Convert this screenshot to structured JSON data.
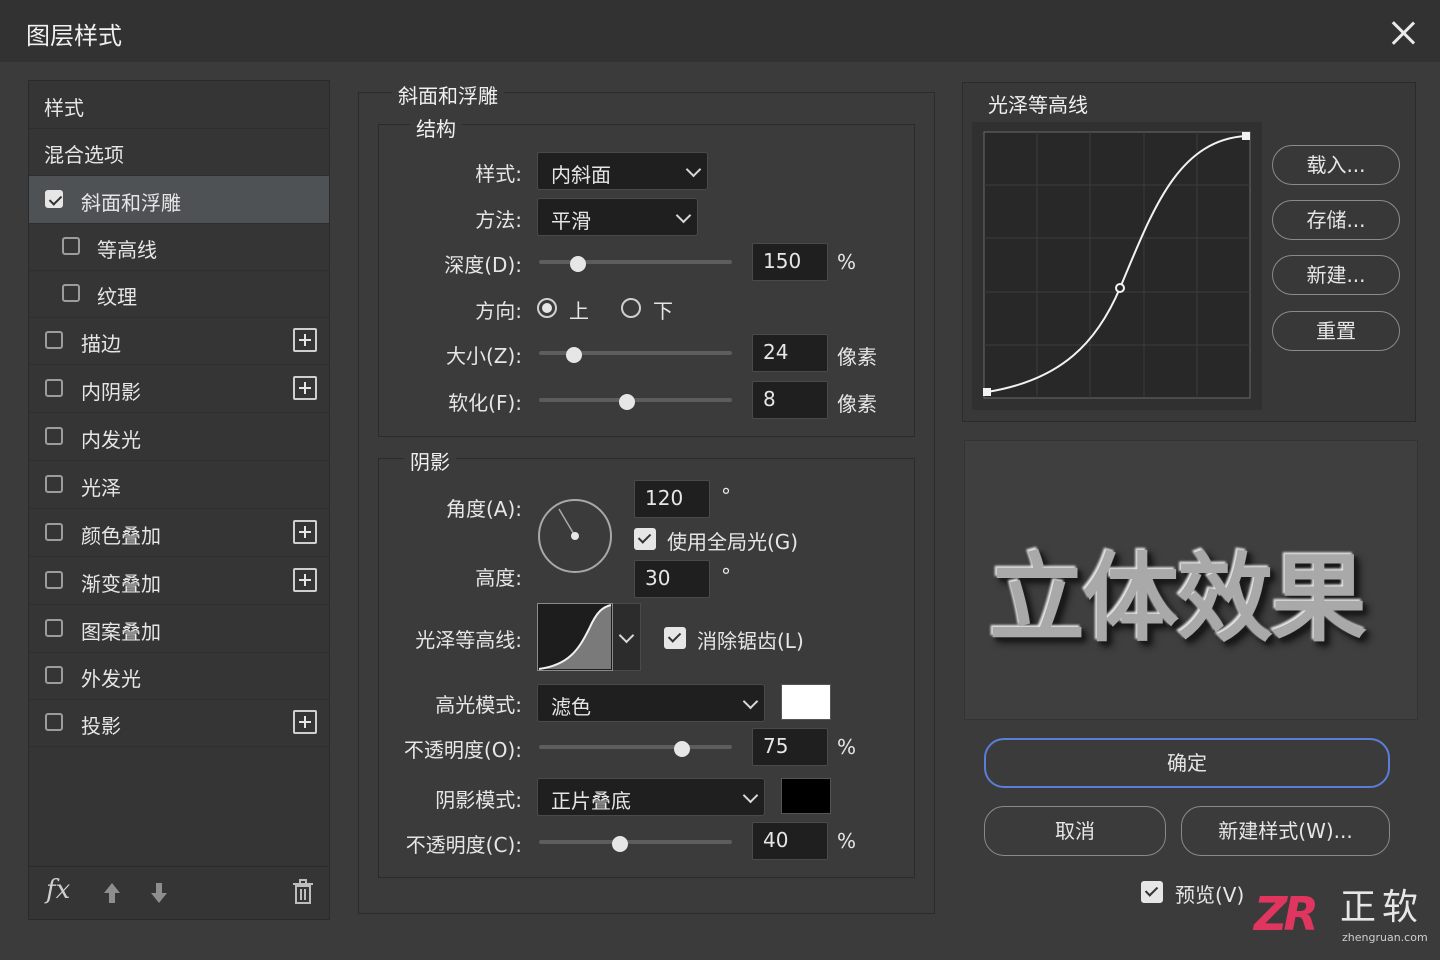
{
  "window": {
    "title": "图层样式"
  },
  "left": {
    "header": "样式",
    "blend": "混合选项",
    "items": [
      {
        "label": "斜面和浮雕",
        "checked": true
      },
      {
        "label": "等高线",
        "checked": false
      },
      {
        "label": "纹理",
        "checked": false
      },
      {
        "label": "描边",
        "checked": false
      },
      {
        "label": "内阴影",
        "checked": false
      },
      {
        "label": "内发光",
        "checked": false
      },
      {
        "label": "光泽",
        "checked": false
      },
      {
        "label": "颜色叠加",
        "checked": false
      },
      {
        "label": "渐变叠加",
        "checked": false
      },
      {
        "label": "图案叠加",
        "checked": false
      },
      {
        "label": "外发光",
        "checked": false
      },
      {
        "label": "投影",
        "checked": false
      }
    ],
    "fx": "fx"
  },
  "bevel": {
    "title": "斜面和浮雕",
    "structure": {
      "title": "结构",
      "style_label": "样式:",
      "style_value": "内斜面",
      "method_label": "方法:",
      "method_value": "平滑",
      "depth_label": "深度(D):",
      "depth_value": "150",
      "depth_unit": "%",
      "depth_pos": 0.2,
      "direction_label": "方向:",
      "dir_up": "上",
      "dir_down": "下",
      "size_label": "大小(Z):",
      "size_value": "24",
      "size_unit": "像素",
      "size_pos": 0.18,
      "soften_label": "软化(F):",
      "soften_value": "8",
      "soften_unit": "像素",
      "soften_pos": 0.45
    },
    "shading": {
      "title": "阴影",
      "angle_label": "角度(A):",
      "angle_value": "120",
      "degree": "°",
      "global_light": "使用全局光(G)",
      "altitude_label": "高度:",
      "altitude_value": "30",
      "gloss_label": "光泽等高线:",
      "antialias": "消除锯齿(L)",
      "highlight_label": "高光模式:",
      "highlight_mode": "滤色",
      "highlight_color": "#ffffff",
      "hopacity_label": "不透明度(O):",
      "hopacity_value": "75",
      "hopacity_unit": "%",
      "hopacity_pos": 0.75,
      "shadow_label": "阴影模式:",
      "shadow_mode": "正片叠底",
      "shadow_color": "#000000",
      "sopacity_label": "不透明度(C):",
      "sopacity_value": "40",
      "sopacity_unit": "%",
      "sopacity_pos": 0.42
    }
  },
  "contour": {
    "title": "光泽等高线",
    "load": "载入...",
    "save": "存储...",
    "new": "新建...",
    "reset": "重置"
  },
  "preview": {
    "text": "立体效果"
  },
  "actions": {
    "ok": "确定",
    "cancel": "取消",
    "new_style": "新建样式(W)...",
    "preview": "预览(V)"
  },
  "watermark": {
    "logo": "ZR",
    "cn": "正软",
    "url": "zhengruan.com"
  }
}
